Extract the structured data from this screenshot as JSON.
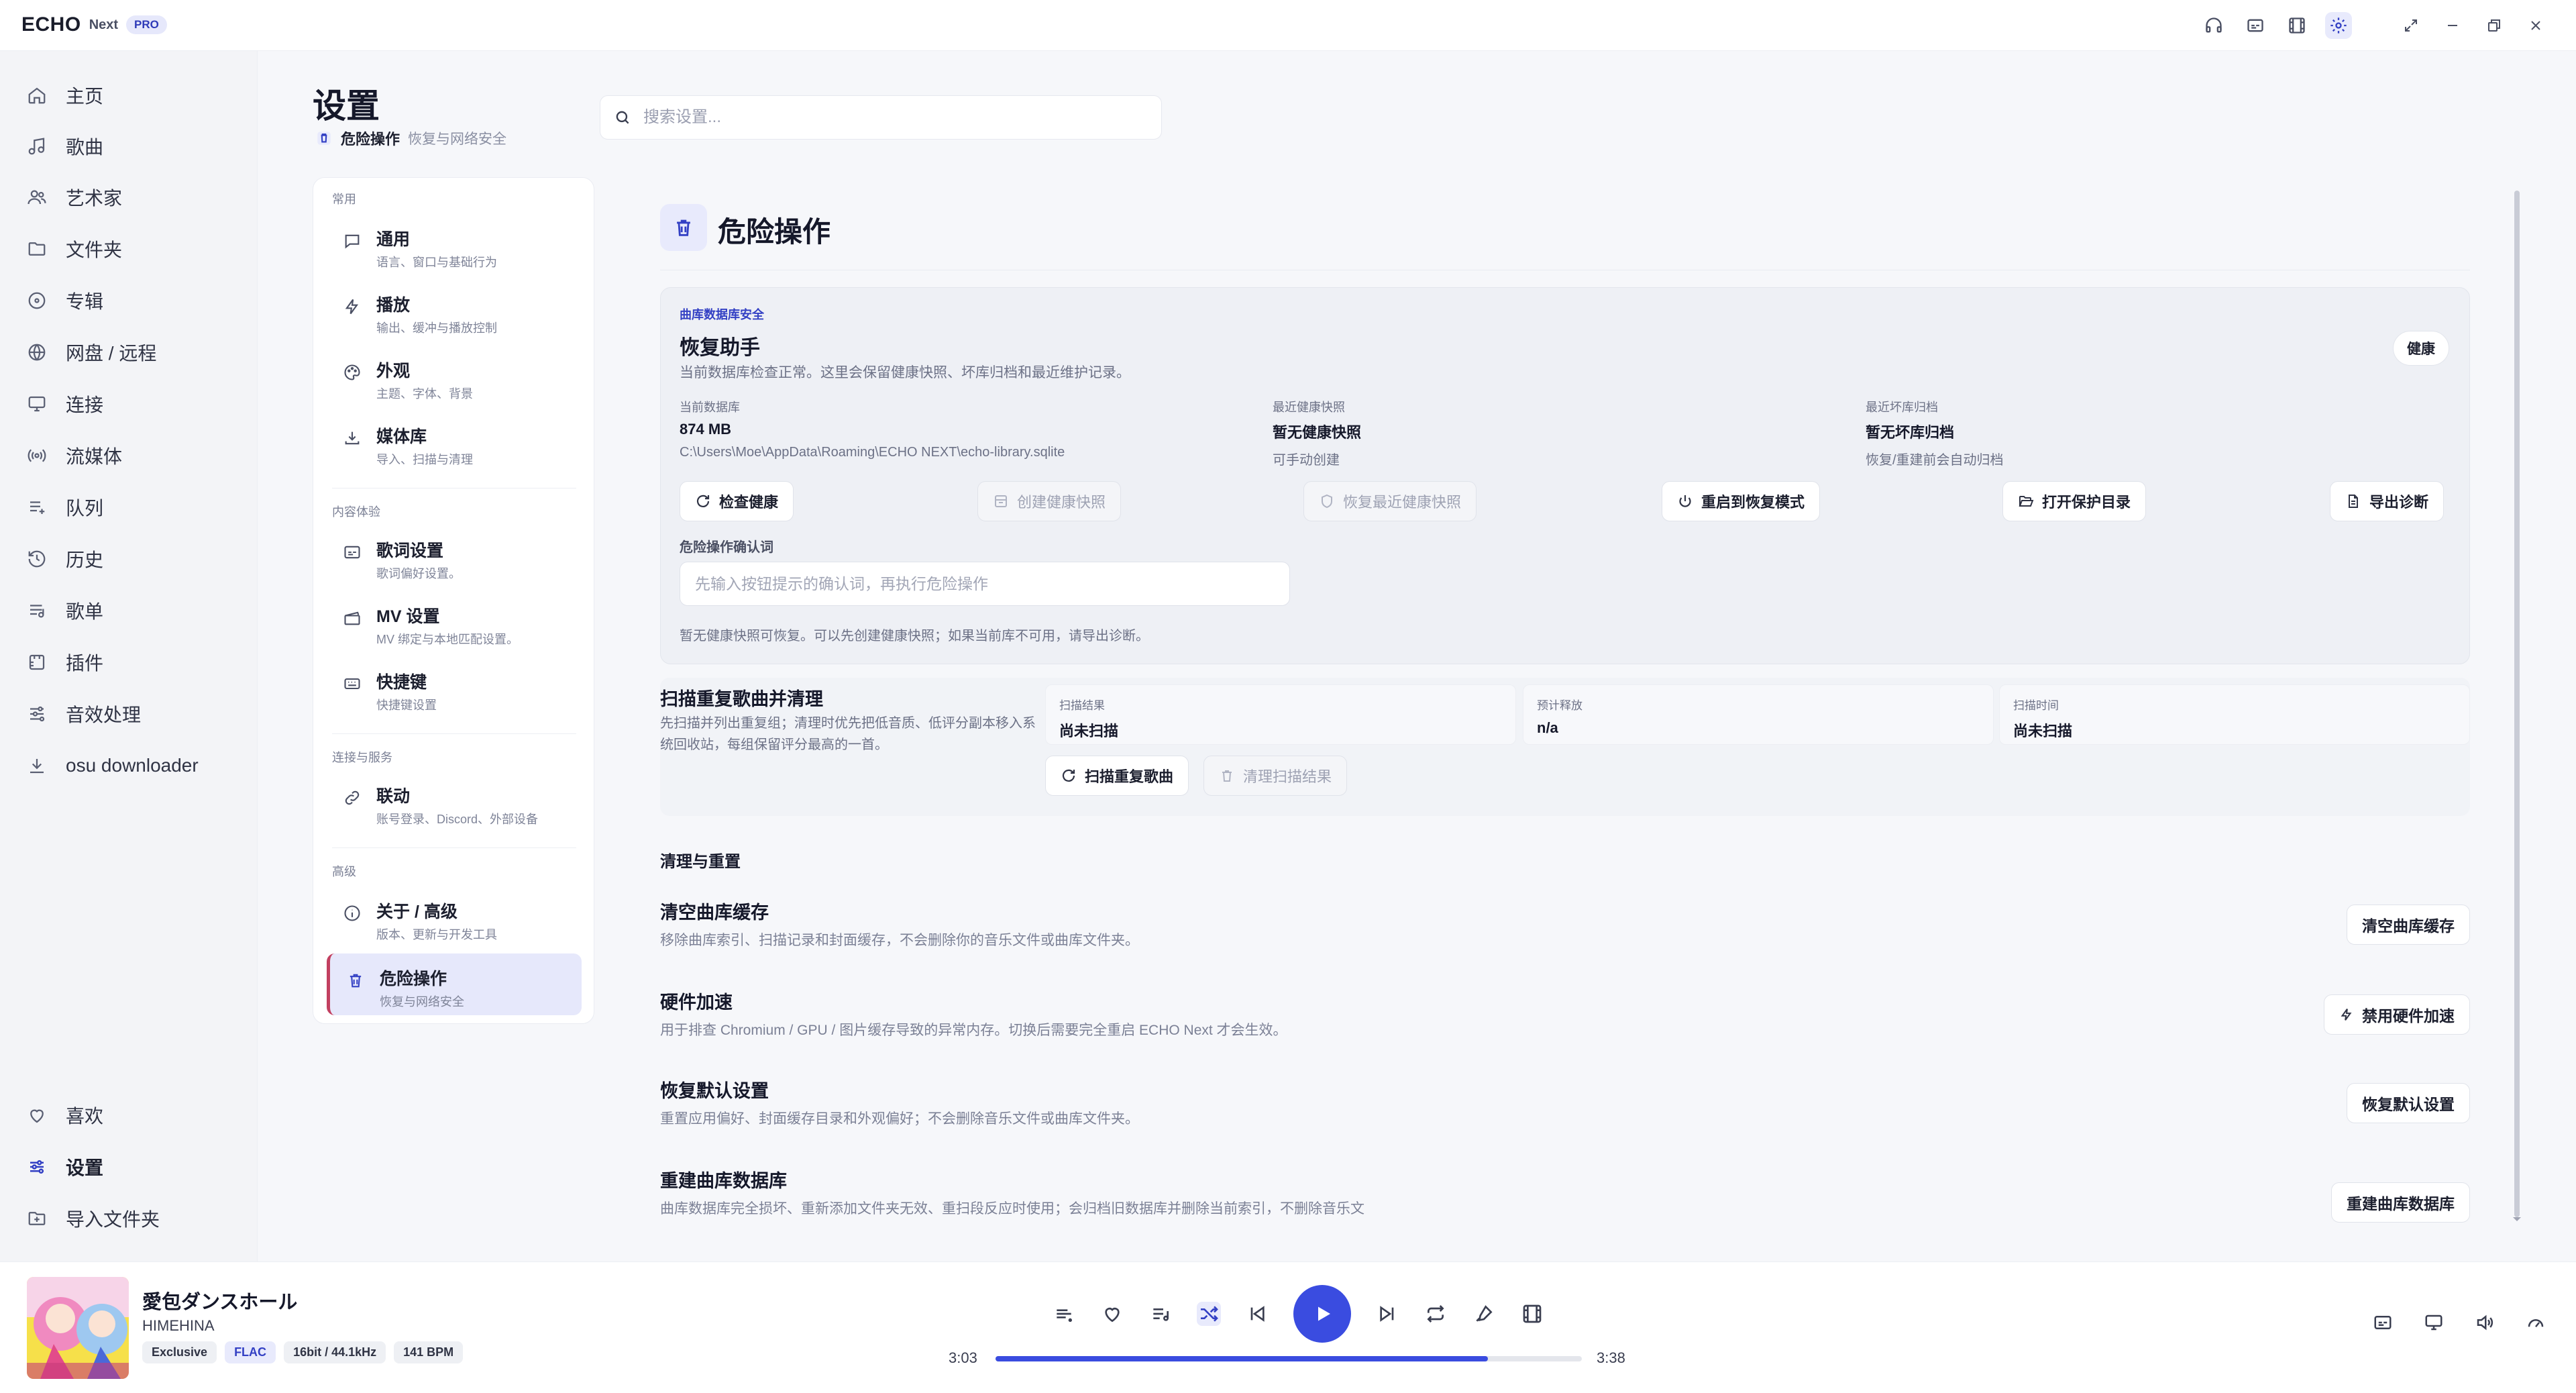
{
  "app": {
    "logo": "ECHO",
    "logo_sub": "Next",
    "badge": "PRO"
  },
  "titlebar_icons": [
    "headphones-icon",
    "caption-icon",
    "film-icon",
    "gear-icon",
    "expand-icon",
    "minimize-icon",
    "restore-icon",
    "close-icon"
  ],
  "nav": {
    "items": [
      {
        "label": "主页",
        "icon": "home-icon"
      },
      {
        "label": "歌曲",
        "icon": "music-note-icon"
      },
      {
        "label": "艺术家",
        "icon": "users-icon"
      },
      {
        "label": "文件夹",
        "icon": "folder-icon"
      },
      {
        "label": "专辑",
        "icon": "disc-icon"
      },
      {
        "label": "网盘 / 远程",
        "icon": "globe-icon"
      },
      {
        "label": "连接",
        "icon": "connect-icon"
      },
      {
        "label": "流媒体",
        "icon": "stream-icon"
      },
      {
        "label": "队列",
        "icon": "queue-icon"
      },
      {
        "label": "历史",
        "icon": "history-icon"
      },
      {
        "label": "歌单",
        "icon": "playlist-icon"
      },
      {
        "label": "插件",
        "icon": "plugin-icon"
      },
      {
        "label": "音效处理",
        "icon": "equalizer-icon"
      },
      {
        "label": "osu downloader",
        "icon": "download-icon"
      }
    ],
    "bottom": [
      {
        "label": "喜欢",
        "icon": "heart-icon"
      },
      {
        "label": "设置",
        "icon": "settings-sliders-icon"
      },
      {
        "label": "导入文件夹",
        "icon": "folder-import-icon"
      }
    ]
  },
  "settings": {
    "title": "设置",
    "crumb_label": "危险操作",
    "crumb_sub": "恢复与网络安全",
    "search_placeholder": "搜索设置..."
  },
  "subnav": {
    "groups": [
      "常用",
      "内容体验",
      "连接与服务",
      "高级"
    ],
    "items": [
      {
        "title": "通用",
        "sub": "语言、窗口与基础行为"
      },
      {
        "title": "播放",
        "sub": "输出、缓冲与播放控制"
      },
      {
        "title": "外观",
        "sub": "主题、字体、背景"
      },
      {
        "title": "媒体库",
        "sub": "导入、扫描与清理"
      },
      {
        "title": "歌词设置",
        "sub": "歌词偏好设置。"
      },
      {
        "title": "MV 设置",
        "sub": "MV 绑定与本地匹配设置。"
      },
      {
        "title": "快捷键",
        "sub": "快捷键设置"
      },
      {
        "title": "联动",
        "sub": "账号登录、Discord、外部设备"
      },
      {
        "title": "关于 / 高级",
        "sub": "版本、更新与开发工具"
      },
      {
        "title": "危险操作",
        "sub": "恢复与网络安全"
      }
    ]
  },
  "section": {
    "title": "危险操作"
  },
  "recovery": {
    "tag": "曲库数据库安全",
    "title": "恢复助手",
    "desc": "当前数据库检查正常。这里会保留健康快照、坏库归档和最近维护记录。",
    "badge": "健康",
    "info": [
      {
        "label": "当前数据库",
        "value": "874 MB",
        "sub": "C:\\Users\\Moe\\AppData\\Roaming\\ECHO NEXT\\echo-library.sqlite"
      },
      {
        "label": "最近健康快照",
        "value": "暂无健康快照",
        "sub": "可手动创建"
      },
      {
        "label": "最近坏库归档",
        "value": "暂无坏库归档",
        "sub": "恢复/重建前会自动归档"
      }
    ],
    "buttons": [
      "检查健康",
      "创建健康快照",
      "恢复最近健康快照",
      "重启到恢复模式",
      "打开保护目录",
      "导出诊断"
    ],
    "confirm_label": "危险操作确认词",
    "confirm_placeholder": "先输入按钮提示的确认词，再执行危险操作",
    "note": "暂无健康快照可恢复。可以先创建健康快照；如果当前库不可用，请导出诊断。"
  },
  "dupscan": {
    "title": "扫描重复歌曲并清理",
    "desc": "先扫描并列出重复组；清理时优先把低音质、低评分副本移入系统回收站，每组保留评分最高的一首。",
    "stats": [
      {
        "label": "扫描结果",
        "value": "尚未扫描"
      },
      {
        "label": "预计释放",
        "value": "n/a"
      },
      {
        "label": "扫描时间",
        "value": "尚未扫描"
      }
    ],
    "scan_btn": "扫描重复歌曲",
    "clear_btn": "清理扫描结果"
  },
  "cleanup": {
    "heading": "清理与重置",
    "rows": [
      {
        "title": "清空曲库缓存",
        "desc": "移除曲库索引、扫描记录和封面缓存，不会删除你的音乐文件或曲库文件夹。",
        "btn": "清空曲库缓存"
      },
      {
        "title": "硬件加速",
        "desc": "用于排查 Chromium / GPU / 图片缓存导致的异常内存。切换后需要完全重启 ECHO Next 才会生效。",
        "btn": "禁用硬件加速"
      },
      {
        "title": "恢复默认设置",
        "desc": "重置应用偏好、封面缓存目录和外观偏好；不会删除音乐文件或曲库文件夹。",
        "btn": "恢复默认设置"
      },
      {
        "title": "重建曲库数据库",
        "desc": "曲库数据库完全损坏、重新添加文件夹无效、重扫段反应时使用；会归档旧数据库并删除当前索引，不删除音乐文",
        "btn": "重建曲库数据库"
      }
    ]
  },
  "player": {
    "title": "愛包ダンスホール",
    "artist": "HIMEHINA",
    "tags": [
      "Exclusive",
      "FLAC",
      "16bit / 44.1kHz",
      "141 BPM"
    ],
    "elapsed": "3:03",
    "duration": "3:38",
    "progress": 0.84,
    "accent": "#3a4ce0"
  }
}
